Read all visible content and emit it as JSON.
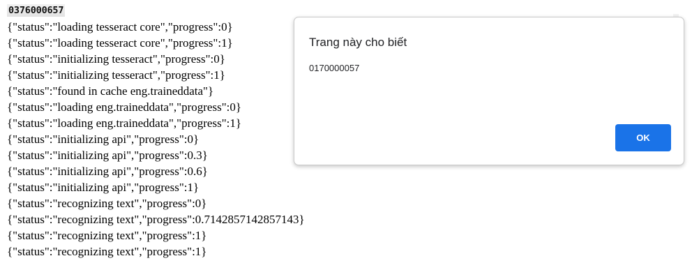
{
  "page": {
    "captcha_text": "0376000657",
    "log_lines": [
      "{\"status\":\"loading tesseract core\",\"progress\":0}",
      "{\"status\":\"loading tesseract core\",\"progress\":1}",
      "{\"status\":\"initializing tesseract\",\"progress\":0}",
      "{\"status\":\"initializing tesseract\",\"progress\":1}",
      "{\"status\":\"found in cache eng.traineddata\"}",
      "{\"status\":\"loading eng.traineddata\",\"progress\":0}",
      "{\"status\":\"loading eng.traineddata\",\"progress\":1}",
      "{\"status\":\"initializing api\",\"progress\":0}",
      "{\"status\":\"initializing api\",\"progress\":0.3}",
      "{\"status\":\"initializing api\",\"progress\":0.6}",
      "{\"status\":\"initializing api\",\"progress\":1}",
      "{\"status\":\"recognizing text\",\"progress\":0}",
      "{\"status\":\"recognizing text\",\"progress\":0.7142857142857143}",
      "{\"status\":\"recognizing text\",\"progress\":1}",
      "{\"status\":\"recognizing text\",\"progress\":1}"
    ]
  },
  "alert": {
    "title": "Trang này cho biết",
    "message": "0170000057",
    "ok_label": "OK",
    "ok_color": "#1a73e8"
  }
}
